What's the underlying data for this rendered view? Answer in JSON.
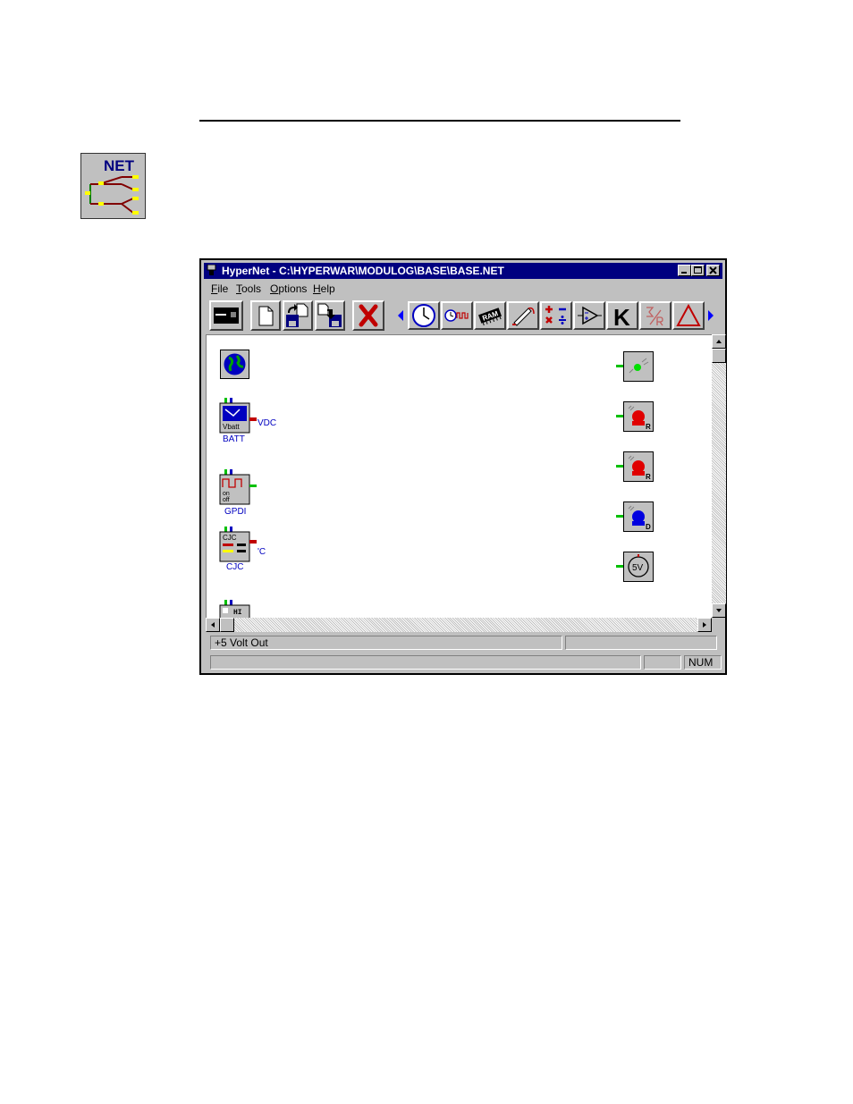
{
  "window": {
    "title": "HyperNet - C:\\HYPERWAR\\MODULOG\\BASE\\BASE.NET"
  },
  "menu": {
    "items": [
      {
        "label": "File",
        "key": "F",
        "rest": "ile"
      },
      {
        "label": "Tools",
        "key": "T",
        "rest": "ools"
      },
      {
        "label": "Options",
        "key": "O",
        "rest": "ptions"
      },
      {
        "label": "Help",
        "key": "H",
        "rest": "elp"
      }
    ]
  },
  "toolbar": {
    "buttons": [
      "terminal-icon",
      "new-file-icon",
      "open-file-icon",
      "save-file-icon",
      "delete-icon",
      "scroll-left-icon",
      "clock-icon",
      "timer-pulse-icon",
      "ram-chip-icon",
      "pen-icon",
      "arithmetic-icon",
      "amplifier-icon",
      "k-constant-icon",
      "sigma-icon",
      "delta-icon",
      "scroll-right-icon"
    ],
    "ram_text": "RAM",
    "k_text": "K"
  },
  "nodes": {
    "batt": {
      "label": "BATT",
      "output": "VDC",
      "icon_text": "Vbatt"
    },
    "gpdi": {
      "label": "GPDI",
      "icon_text1": "on",
      "icon_text2": "off"
    },
    "cjc": {
      "label": "CJC",
      "output": "'C",
      "icon_text": "CJC"
    },
    "hi": {
      "icon_text": "HI"
    },
    "relay_r1": {
      "tag": "R"
    },
    "relay_r2": {
      "tag": "R"
    },
    "relay_d": {
      "tag": "D"
    },
    "supply": {
      "tag": "5V"
    }
  },
  "status": {
    "message": "+5 Volt Out",
    "indicator": "NUM"
  },
  "colors": {
    "titlebar": "#000080",
    "face": "#c0c0c0",
    "link_text": "#0000c0"
  }
}
